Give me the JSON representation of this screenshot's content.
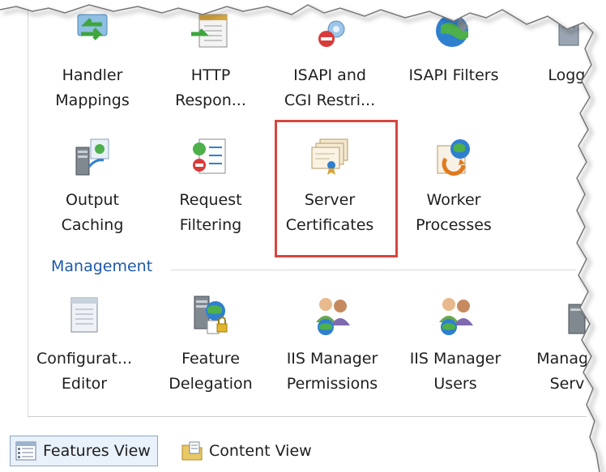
{
  "row1": [
    {
      "id": "handler-mappings",
      "lines": [
        "Handler",
        "Mappings"
      ],
      "icon": "handler-mappings-icon"
    },
    {
      "id": "http-response",
      "lines": [
        "HTTP",
        "Respon..."
      ],
      "icon": "http-response-icon"
    },
    {
      "id": "isapi-cgi",
      "lines": [
        "ISAPI and",
        "CGI Restri..."
      ],
      "icon": "isapi-cgi-icon"
    },
    {
      "id": "isapi-filters",
      "lines": [
        "ISAPI Filters"
      ],
      "icon": "isapi-filters-icon"
    },
    {
      "id": "logging",
      "lines": [
        "Loggin"
      ],
      "icon": "logging-icon"
    }
  ],
  "row2": [
    {
      "id": "output-caching",
      "lines": [
        "Output",
        "Caching"
      ],
      "icon": "output-caching-icon"
    },
    {
      "id": "request-filtering",
      "lines": [
        "Request",
        "Filtering"
      ],
      "icon": "request-filtering-icon"
    },
    {
      "id": "server-certificates",
      "lines": [
        "Server",
        "Certificates"
      ],
      "icon": "server-certificates-icon",
      "selected": true
    },
    {
      "id": "worker-processes",
      "lines": [
        "Worker",
        "Processes"
      ],
      "icon": "worker-processes-icon"
    }
  ],
  "management": {
    "title": "Management"
  },
  "row3": [
    {
      "id": "configuration-editor",
      "lines": [
        "Configurat...",
        "Editor"
      ],
      "icon": "configuration-editor-icon"
    },
    {
      "id": "feature-delegation",
      "lines": [
        "Feature",
        "Delegation"
      ],
      "icon": "feature-delegation-icon"
    },
    {
      "id": "iis-manager-permissions",
      "lines": [
        "IIS Manager",
        "Permissions"
      ],
      "icon": "iis-manager-permissions-icon"
    },
    {
      "id": "iis-manager-users",
      "lines": [
        "IIS Manager",
        "Users"
      ],
      "icon": "iis-manager-users-icon"
    },
    {
      "id": "management-service",
      "lines": [
        "Manage",
        "Serv"
      ],
      "icon": "management-service-icon"
    }
  ],
  "status": {
    "features_view": "Features View",
    "content_view": "Content View"
  },
  "colors": {
    "accent": "#1e5aa8",
    "selection": "#d8453f"
  }
}
